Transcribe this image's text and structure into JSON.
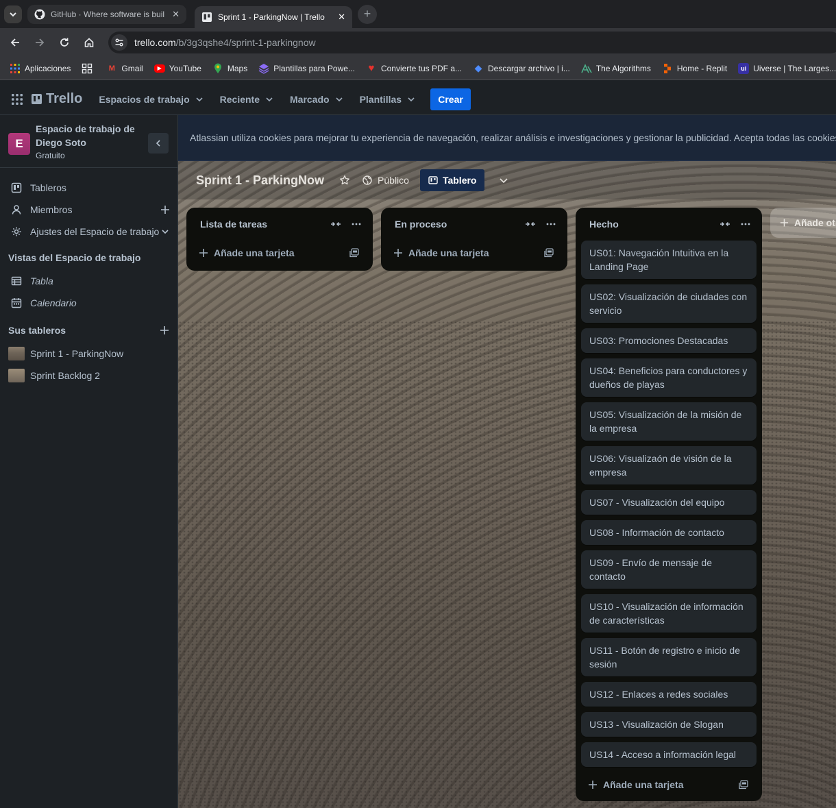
{
  "browser": {
    "tabs": [
      {
        "title": "GitHub · Where software is buil",
        "icon": "github-icon",
        "active": false
      },
      {
        "title": "Sprint 1 - ParkingNow | Trello",
        "icon": "trello-icon",
        "active": true
      }
    ],
    "url_host": "trello.com",
    "url_path": "/b/3g3qshe4/sprint-1-parkingnow",
    "bookmarks": [
      {
        "label": "Aplicaciones",
        "icon": "apps-grid-icon"
      },
      {
        "label": "Gmail",
        "icon": "gmail-icon",
        "color": "#ea4335"
      },
      {
        "label": "YouTube",
        "icon": "youtube-icon",
        "color": "#ff0000"
      },
      {
        "label": "Maps",
        "icon": "maps-pin-icon",
        "color": "#34a853"
      },
      {
        "label": "Plantillas para Powe...",
        "icon": "slides-icon",
        "color": "#7b61ff"
      },
      {
        "label": "Convierte tus PDF a...",
        "icon": "pdf-heart-icon",
        "color": "#e5322d"
      },
      {
        "label": "Descargar archivo | i...",
        "icon": "diamond-icon",
        "color": "#4e8cff"
      },
      {
        "label": "The Algorithms",
        "icon": "algorithms-icon",
        "color": "#4caf8a"
      },
      {
        "label": "Home - Replit",
        "icon": "replit-icon",
        "color": "#f26207"
      },
      {
        "label": "Uiverse | The Larges...",
        "icon": "uiverse-icon",
        "color": "#4338ca"
      }
    ]
  },
  "header": {
    "logo": "Trello",
    "nav": [
      "Espacios de trabajo",
      "Reciente",
      "Marcado",
      "Plantillas"
    ],
    "create_label": "Crear"
  },
  "sidebar": {
    "workspace_name": "Espacio de trabajo de Diego Soto",
    "workspace_initial": "E",
    "workspace_plan": "Gratuito",
    "items": [
      {
        "label": "Tableros",
        "icon": "board-icon"
      },
      {
        "label": "Miembros",
        "icon": "person-icon"
      },
      {
        "label": "Ajustes del Espacio de trabajo",
        "icon": "gear-icon"
      }
    ],
    "views_title": "Vistas del Espacio de trabajo",
    "views": [
      {
        "label": "Tabla",
        "icon": "table-icon"
      },
      {
        "label": "Calendario",
        "icon": "calendar-icon"
      }
    ],
    "boards_title": "Sus tableros",
    "boards": [
      "Sprint 1 - ParkingNow",
      "Sprint Backlog 2"
    ]
  },
  "cookie_banner": "Atlassian utiliza cookies para mejorar tu experiencia de navegación, realizar análisis e investigaciones y gestionar la publicidad. Acepta todas las cookies para",
  "board": {
    "title": "Sprint 1 - ParkingNow",
    "visibility": "Público",
    "view_label": "Tablero",
    "add_card_label": "Añade una tarjeta",
    "add_list_label": "Añade otra lista",
    "lists": [
      {
        "name": "Lista de tareas",
        "cards": []
      },
      {
        "name": "En proceso",
        "cards": []
      },
      {
        "name": "Hecho",
        "cards": [
          "US01: Navegación Intuitiva en la Landing Page",
          "US02: Visualización de ciudades con servicio",
          "US03: Promociones Destacadas",
          "US04: Beneficios para conductores y dueños de playas",
          "US05: Visualización de la misión de la empresa",
          "US06: Visualizaón de visión de la empresa",
          "US07 - Visualización del equipo",
          "US08 - Información de contacto",
          "US09 - Envío de mensaje de contacto",
          "US10 - Visualización de información de características",
          "US11 - Botón de registro e inicio de sesión",
          "US12 - Enlaces a redes sociales",
          "US13 - Visualización de Slogan",
          "US14 - Acceso a información legal"
        ]
      }
    ]
  }
}
